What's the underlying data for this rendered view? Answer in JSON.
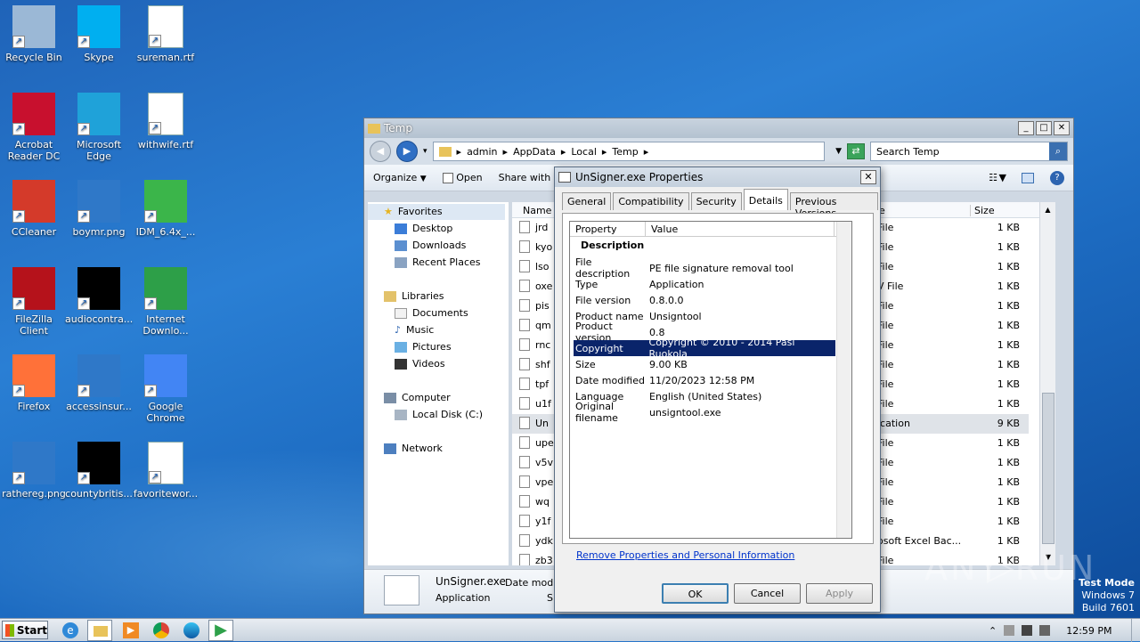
{
  "desktop": {
    "icons": [
      {
        "label": "Recycle Bin",
        "color": "#9bb8d6"
      },
      {
        "label": "Skype",
        "color": "#00aff0"
      },
      {
        "label": "sureman.rtf",
        "color": "#ffffff"
      },
      {
        "label": "Acrobat Reader DC",
        "color": "#c8102e"
      },
      {
        "label": "Microsoft Edge",
        "color": "#1fa2d9"
      },
      {
        "label": "withwife.rtf",
        "color": "#ffffff"
      },
      {
        "label": "CCleaner",
        "color": "#d43a2a"
      },
      {
        "label": "boymr.png",
        "color": "#2f78c8"
      },
      {
        "label": "IDM_6.4x_...",
        "color": "#3bb54a"
      },
      {
        "label": "FileZilla Client",
        "color": "#b5121b"
      },
      {
        "label": "audiocontra...",
        "color": "#000000"
      },
      {
        "label": "Internet Downlo...",
        "color": "#2d9f48"
      },
      {
        "label": "Firefox",
        "color": "#ff7139"
      },
      {
        "label": "accessinsur...",
        "color": "#2f78c8"
      },
      {
        "label": "Google Chrome",
        "color": "#4285f4"
      },
      {
        "label": "rathereg.png",
        "color": "#2f78c8"
      },
      {
        "label": "countybritis...",
        "color": "#000000"
      },
      {
        "label": "favoritewor...",
        "color": "#ffffff"
      }
    ]
  },
  "explorer": {
    "title": "Temp",
    "breadcrumb": [
      "admin",
      "AppData",
      "Local",
      "Temp"
    ],
    "search_placeholder": "Search Temp",
    "toolbar": {
      "organize": "Organize",
      "open": "Open",
      "share_with": "Share with"
    },
    "nav": {
      "favorites": "Favorites",
      "desktop": "Desktop",
      "downloads": "Downloads",
      "recent": "Recent Places",
      "libraries": "Libraries",
      "documents": "Documents",
      "music": "Music",
      "pictures": "Pictures",
      "videos": "Videos",
      "computer": "Computer",
      "local_disk": "Local Disk (C:)",
      "network": "Network"
    },
    "columns": {
      "name": "Name",
      "type_tail": "e",
      "size": "Size"
    },
    "rows": [
      {
        "name": "jrd",
        "type": "File",
        "size": "1 KB"
      },
      {
        "name": "kyo",
        "type": "File",
        "size": "1 KB"
      },
      {
        "name": "lso",
        "type": "File",
        "size": "1 KB"
      },
      {
        "name": "oxe",
        "type": "V File",
        "size": "1 KB"
      },
      {
        "name": "pis",
        "type": "File",
        "size": "1 KB"
      },
      {
        "name": "qm",
        "type": "File",
        "size": "1 KB"
      },
      {
        "name": "rnc",
        "type": "File",
        "size": "1 KB"
      },
      {
        "name": "shf",
        "type": "File",
        "size": "1 KB"
      },
      {
        "name": "tpf",
        "type": "File",
        "size": "1 KB"
      },
      {
        "name": "u1f",
        "type": "File",
        "size": "1 KB"
      },
      {
        "name": "Un",
        "type": "ication",
        "size": "9 KB"
      },
      {
        "name": "upe",
        "type": "File",
        "size": "1 KB"
      },
      {
        "name": "v5v",
        "type": "File",
        "size": "1 KB"
      },
      {
        "name": "vpe",
        "type": "File",
        "size": "1 KB"
      },
      {
        "name": "wq",
        "type": "File",
        "size": "1 KB"
      },
      {
        "name": "y1f",
        "type": "File",
        "size": "1 KB"
      },
      {
        "name": "ydk",
        "type": "osoft Excel Bac...",
        "size": "1 KB"
      },
      {
        "name": "zb3",
        "type": "File",
        "size": "1 KB"
      }
    ],
    "details": {
      "filename": "UnSigner.exe",
      "date_label": "Date modifi",
      "type": "Application",
      "size_label": "Si"
    }
  },
  "dialog": {
    "title": "UnSigner.exe Properties",
    "tabs": [
      "General",
      "Compatibility",
      "Security",
      "Details",
      "Previous Versions"
    ],
    "active_tab": "Details",
    "col_property": "Property",
    "col_value": "Value",
    "section": "Description",
    "props": [
      {
        "k": "File description",
        "v": "PE file signature removal tool"
      },
      {
        "k": "Type",
        "v": "Application"
      },
      {
        "k": "File version",
        "v": "0.8.0.0"
      },
      {
        "k": "Product name",
        "v": "Unsigntool"
      },
      {
        "k": "Product version",
        "v": "0.8"
      },
      {
        "k": "Copyright",
        "v": "Copyright © 2010 - 2014 Pasi Ruokola"
      },
      {
        "k": "Size",
        "v": "9.00 KB"
      },
      {
        "k": "Date modified",
        "v": "11/20/2023 12:58 PM"
      },
      {
        "k": "Language",
        "v": "English (United States)"
      },
      {
        "k": "Original filename",
        "v": "unsigntool.exe"
      }
    ],
    "remove_link": "Remove Properties and Personal Information",
    "ok": "OK",
    "cancel": "Cancel",
    "apply": "Apply"
  },
  "taskbar": {
    "start": "Start",
    "clock": "12:59 PM"
  },
  "watermark": {
    "mode": "Test Mode",
    "os": "Windows 7",
    "build": "Build 7601",
    "brand": "ANY RUN"
  }
}
